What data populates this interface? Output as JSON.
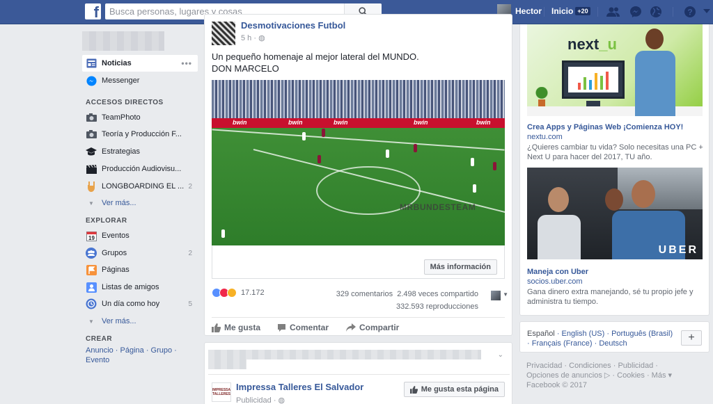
{
  "header": {
    "logo": "f",
    "search_placeholder": "Busca personas, lugares y cosas",
    "user_name": "Hector",
    "home_label": "Inicio",
    "home_badge": "+20",
    "icons": [
      "friend-requests-icon",
      "messenger-icon",
      "globe-notifications-icon",
      "help-icon"
    ]
  },
  "sidebar": {
    "main_items": [
      {
        "label": "Noticias",
        "icon": "news-feed-icon"
      },
      {
        "label": "Messenger",
        "icon": "messenger-icon"
      }
    ],
    "shortcuts_title": "ACCESOS DIRECTOS",
    "shortcuts": [
      {
        "label": "TeamPhoto",
        "count": ""
      },
      {
        "label": "Teoría y Producción F...",
        "count": ""
      },
      {
        "label": "Estrategias",
        "count": ""
      },
      {
        "label": "Producción Audiovisu...",
        "count": ""
      },
      {
        "label": "LONGBOARDING EL ...",
        "count": "2"
      }
    ],
    "see_more_1": "Ver más...",
    "explore_title": "EXPLORAR",
    "explore": [
      {
        "label": "Eventos",
        "count": "",
        "icon_text": "19"
      },
      {
        "label": "Grupos",
        "count": "2"
      },
      {
        "label": "Páginas",
        "count": ""
      },
      {
        "label": "Listas de amigos",
        "count": ""
      },
      {
        "label": "Un día como hoy",
        "count": "5"
      }
    ],
    "see_more_2": "Ver más...",
    "create_title": "CREAR",
    "create_links": "Anuncio · Página · Grupo · Evento"
  },
  "post": {
    "page_name": "Desmotivaciones Futbol",
    "time": "5 h · ",
    "text_line1": "Un pequeño homenaje al mejor lateral del MUNDO.",
    "text_line2": "DON MARCELO",
    "video_boards": [
      "bwin",
      "bwin",
      "bwin",
      "bwin",
      "bwin"
    ],
    "video_watermark": "MRBUNDESTEAM",
    "more_info": "Más información",
    "reactions_count": "17.172",
    "comments": "329 comentarios",
    "shares": "2.498 veces compartido",
    "views": "332.593 reproducciones",
    "action_like": "Me gusta",
    "action_comment": "Comentar",
    "action_share": "Compartir"
  },
  "post2": {
    "page_name": "Impressa Talleres El Salvador",
    "sub": "Publicidad · ",
    "logo_text": "IMPRESSA TALLERES",
    "like_page": "Me gusta esta página"
  },
  "ads": [
    {
      "brand": "next",
      "brand_accent": "_u",
      "title": "Crea Apps y Páginas Web ¡Comienza HOY!",
      "url": "nextu.com",
      "desc": "¿Quieres cambiar tu vida? Solo necesitas una PC + Next U para hacer del 2017, TU año."
    },
    {
      "brand": "UBER",
      "title": "Maneja con Uber",
      "url": "socios.uber.com",
      "desc": "Gana dinero extra manejando, sé tu propio jefe y administra tu tiempo."
    }
  ],
  "languages": {
    "current": "Español",
    "others": [
      "English (US)",
      "Português (Brasil)",
      "Français (France)",
      "Deutsch"
    ],
    "add": "+"
  },
  "footer": {
    "line1": "Privacidad · Condiciones · Publicidad ·",
    "line2": "Opciones de anuncios",
    "line2b": " · Cookies · Más ▾",
    "line3": "Facebook © 2017"
  },
  "colors": {
    "brand_blue": "#3b5998",
    "link_blue": "#365899",
    "background": "#e9ebee"
  }
}
